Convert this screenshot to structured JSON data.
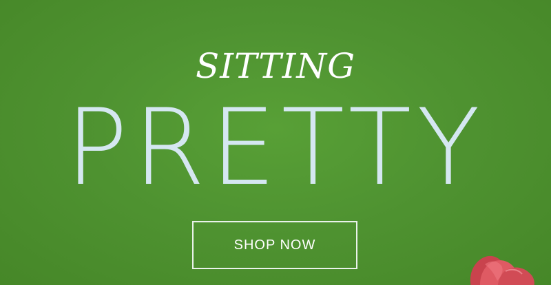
{
  "banner": {
    "headline_top": "SITTING",
    "headline_main": "PRETTY",
    "cta_label": "SHOP NOW"
  },
  "colors": {
    "background": "#4d8f2f",
    "headline_top": "#ffffff",
    "headline_main": "#d5e7f1",
    "cta_border": "#e9f2ea",
    "flower": "#d14b55"
  },
  "icons": {
    "flower": "tulip-flower-image"
  }
}
